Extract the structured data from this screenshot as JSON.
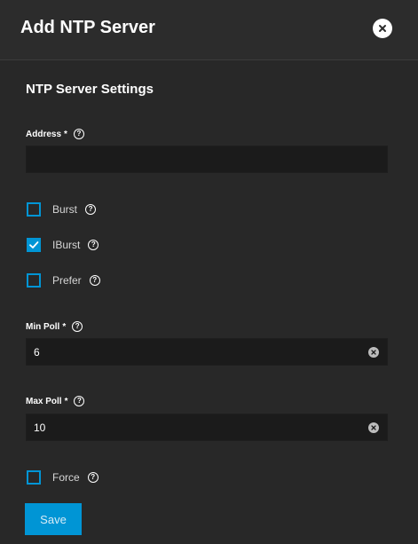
{
  "dialog": {
    "title": "Add NTP Server"
  },
  "section": {
    "title": "NTP Server Settings"
  },
  "address": {
    "label": "Address",
    "required_mark": "*",
    "value": ""
  },
  "checkboxes": [
    {
      "label": "Burst",
      "checked": false
    },
    {
      "label": "IBurst",
      "checked": true
    },
    {
      "label": "Prefer",
      "checked": false
    }
  ],
  "min_poll": {
    "label": "Min Poll",
    "required_mark": "*",
    "value": "6"
  },
  "max_poll": {
    "label": "Max Poll",
    "required_mark": "*",
    "value": "10"
  },
  "force": {
    "label": "Force",
    "checked": false
  },
  "actions": {
    "save_label": "Save"
  },
  "icons": {
    "close": "close-circle-icon",
    "help": "help-circle-icon",
    "clear": "clear-circle-icon",
    "check": "check-icon"
  },
  "colors": {
    "accent": "#0095d5",
    "background": "#282828",
    "input_bg": "#1b1b1b"
  }
}
